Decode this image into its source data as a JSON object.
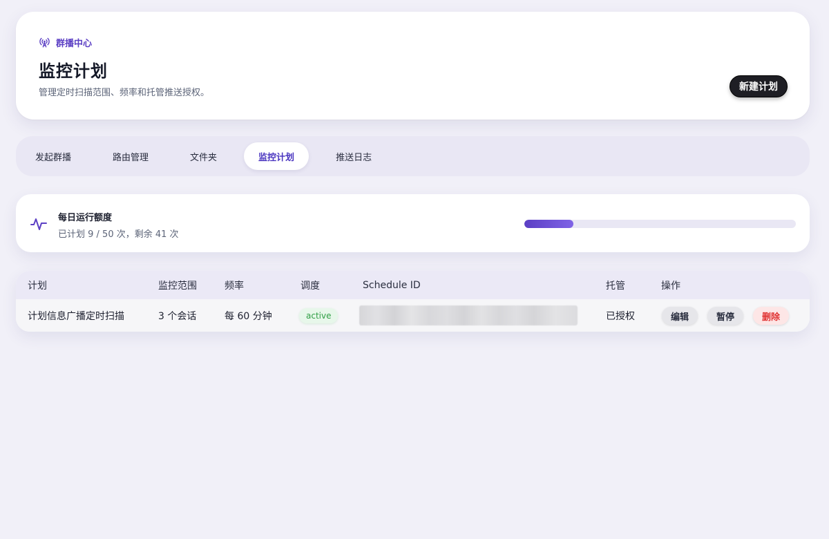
{
  "header": {
    "eyebrow_icon": "broadcast-icon",
    "eyebrow_label": "群播中心",
    "title": "监控计划",
    "subtitle": "管理定时扫描范围、频率和托管推送授权。",
    "new_plan_label": "新建计划"
  },
  "tabs": [
    {
      "label": "发起群播",
      "active": false
    },
    {
      "label": "路由管理",
      "active": false
    },
    {
      "label": "文件夹",
      "active": false
    },
    {
      "label": "监控计划",
      "active": true
    },
    {
      "label": "推送日志",
      "active": false
    }
  ],
  "quota": {
    "icon": "activity-pulse-icon",
    "title": "每日运行额度",
    "detail": "已计划 9 / 50 次，剩余 41 次",
    "used": 9,
    "total": 50
  },
  "table": {
    "columns": [
      "计划",
      "监控范围",
      "频率",
      "调度",
      "Schedule ID",
      "托管",
      "操作"
    ],
    "rows": [
      {
        "plan": "计划信息广播定时扫描",
        "scope": "3 个会话",
        "frequency": "每 60 分钟",
        "schedule_status": "active",
        "schedule_id": "",
        "hosting": "已授权",
        "actions": {
          "edit": "编辑",
          "pause": "暂停",
          "delete": "删除"
        }
      }
    ]
  },
  "colors": {
    "accent": "#5b3fc4",
    "background": "#f1f0f8",
    "active_badge": "#2f9e44",
    "danger": "#e03131"
  }
}
